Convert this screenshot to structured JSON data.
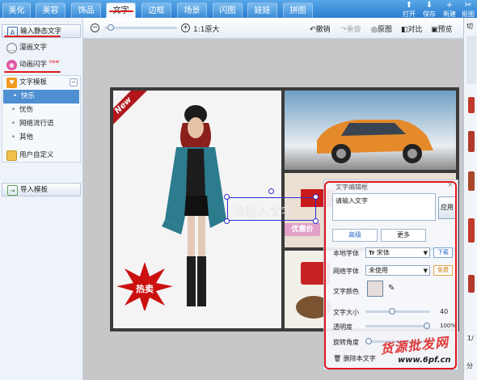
{
  "tabs": [
    {
      "label": "美化",
      "active": false
    },
    {
      "label": "美容",
      "active": false
    },
    {
      "label": "饰品",
      "active": false
    },
    {
      "label": "文字",
      "active": true
    },
    {
      "label": "边框",
      "active": false
    },
    {
      "label": "场景",
      "active": false
    },
    {
      "label": "闪图",
      "active": false
    },
    {
      "label": "娃娃",
      "active": false
    },
    {
      "label": "拼图",
      "active": false
    }
  ],
  "top_actions": {
    "open": "打开",
    "save": "保存",
    "new": "新建",
    "crop": "抠图"
  },
  "toolbar": {
    "zoom_label": "1:1原大",
    "undo": "撤销",
    "redo": "重做",
    "original": "原图",
    "compare": "对比",
    "preview": "预览"
  },
  "sidebar": {
    "static_text": "输入静态文字",
    "comic_text": "漫画文字",
    "animated_text": "动画闪字",
    "new_badge": "new",
    "template_header": "文字模板",
    "template_items": [
      "快乐",
      "忧伤",
      "网络流行语",
      "其他"
    ],
    "user_defined": "用户自定义",
    "import_template": "导入模板"
  },
  "right_panel": {
    "tab_label": "切",
    "side_chars": [
      "分",
      "1/"
    ]
  },
  "canvas": {
    "badge_new": "New",
    "burst_text": "热卖",
    "text_box_placeholder": "请输入文字",
    "youhui": "优惠价",
    "watermark": "货源批发网",
    "watermark_url": "www.6pf.cn"
  },
  "text_panel": {
    "title": "文字编辑框",
    "input_placeholder": "请输入文字",
    "apply": "应用",
    "advanced": "高级",
    "more": "更多",
    "local_font_label": "本地字体",
    "local_font_value": "宋体",
    "download": "下载",
    "web_font_label": "网络字体",
    "web_font_value": "未使用",
    "free": "免费",
    "color_label": "文字颜色",
    "color_value": "#e6dcdc",
    "size_label": "文字大小",
    "size_value": "40",
    "size_fraction": 0.4,
    "opacity_label": "透明度",
    "opacity_value": "100%",
    "opacity_fraction": 1.0,
    "rotate_label": "旋转角度",
    "rotate_fraction": 0.0,
    "delete": "删除本文字"
  },
  "colors": {
    "accent": "#2b7dcf",
    "highlight": "#e3171c"
  }
}
